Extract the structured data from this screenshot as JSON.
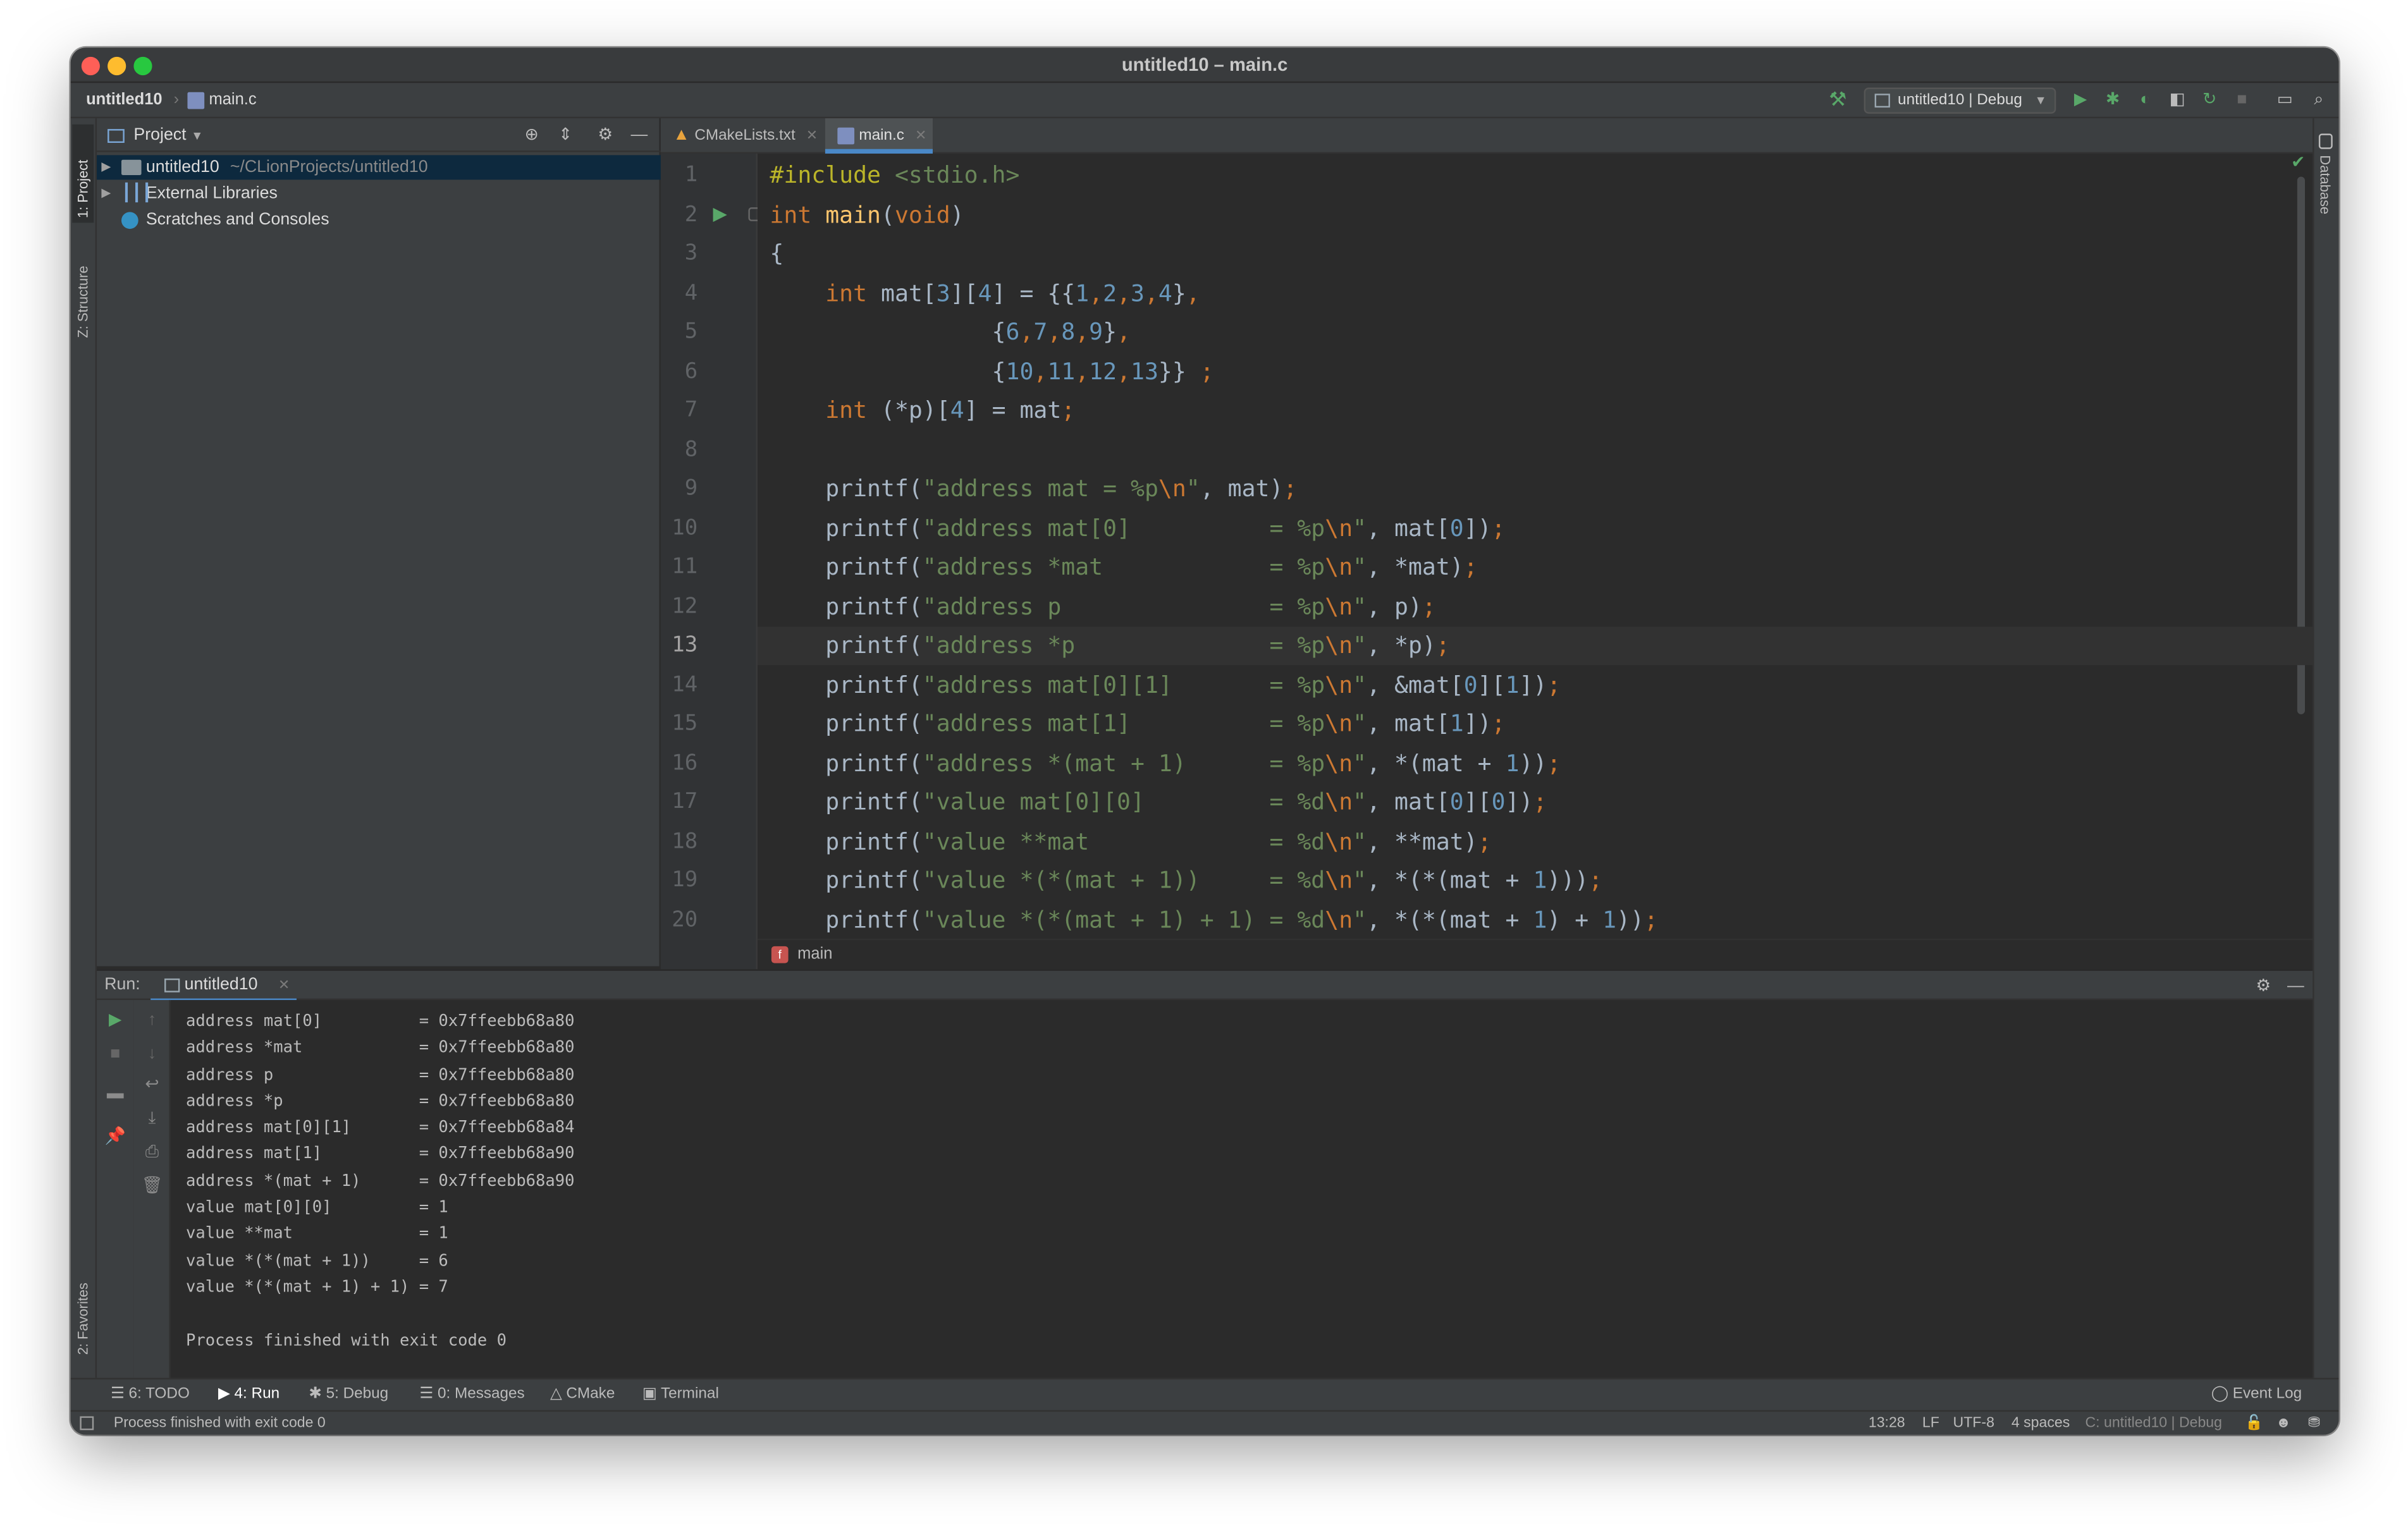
{
  "window": {
    "title": "untitled10 – main.c"
  },
  "nav": {
    "project": "untitled10",
    "file": "main.c",
    "run_config": "untitled10 | Debug"
  },
  "left_stripe": {
    "project": "1: Project",
    "structure": "Z: Structure",
    "favorites": "2: Favorites"
  },
  "right_stripe": {
    "database": "Database"
  },
  "project_panel": {
    "title": "Project",
    "tree": [
      {
        "label": "untitled10",
        "path": "~/CLionProjects/untitled10"
      },
      {
        "label": "External Libraries"
      },
      {
        "label": "Scratches and Consoles"
      }
    ]
  },
  "tabs": [
    {
      "label": "CMakeLists.txt"
    },
    {
      "label": "main.c"
    }
  ],
  "editor": {
    "current_line": 13,
    "breadcrumb": "main",
    "lines": [
      [
        {
          "t": "#include ",
          "c": "#bbb529"
        },
        {
          "t": "<stdio.h>",
          "c": "#6a8759"
        }
      ],
      [
        {
          "t": "int ",
          "c": "#cc7832"
        },
        {
          "t": "main",
          "c": "#ffc66d"
        },
        {
          "t": "(",
          "c": "#a9b7c6"
        },
        {
          "t": "void",
          "c": "#cc7832"
        },
        {
          "t": ")",
          "c": "#a9b7c6"
        }
      ],
      [
        {
          "t": "{",
          "c": "#a9b7c6"
        }
      ],
      [
        {
          "t": "    int ",
          "c": "#cc7832"
        },
        {
          "t": "mat[",
          "c": "#a9b7c6"
        },
        {
          "t": "3",
          "c": "#6897bb"
        },
        {
          "t": "][",
          "c": "#a9b7c6"
        },
        {
          "t": "4",
          "c": "#6897bb"
        },
        {
          "t": "] = {{",
          "c": "#a9b7c6"
        },
        {
          "t": "1",
          "c": "#6897bb"
        },
        {
          "t": ",",
          "c": "#cc7832"
        },
        {
          "t": "2",
          "c": "#6897bb"
        },
        {
          "t": ",",
          "c": "#cc7832"
        },
        {
          "t": "3",
          "c": "#6897bb"
        },
        {
          "t": ",",
          "c": "#cc7832"
        },
        {
          "t": "4",
          "c": "#6897bb"
        },
        {
          "t": "}",
          "c": "#a9b7c6"
        },
        {
          "t": ",",
          "c": "#cc7832"
        }
      ],
      [
        {
          "t": "                {",
          "c": "#a9b7c6"
        },
        {
          "t": "6",
          "c": "#6897bb"
        },
        {
          "t": ",",
          "c": "#cc7832"
        },
        {
          "t": "7",
          "c": "#6897bb"
        },
        {
          "t": ",",
          "c": "#cc7832"
        },
        {
          "t": "8",
          "c": "#6897bb"
        },
        {
          "t": ",",
          "c": "#cc7832"
        },
        {
          "t": "9",
          "c": "#6897bb"
        },
        {
          "t": "}",
          "c": "#a9b7c6"
        },
        {
          "t": ",",
          "c": "#cc7832"
        }
      ],
      [
        {
          "t": "                {",
          "c": "#a9b7c6"
        },
        {
          "t": "10",
          "c": "#6897bb"
        },
        {
          "t": ",",
          "c": "#cc7832"
        },
        {
          "t": "11",
          "c": "#6897bb"
        },
        {
          "t": ",",
          "c": "#cc7832"
        },
        {
          "t": "12",
          "c": "#6897bb"
        },
        {
          "t": ",",
          "c": "#cc7832"
        },
        {
          "t": "13",
          "c": "#6897bb"
        },
        {
          "t": "}} ",
          "c": "#a9b7c6"
        },
        {
          "t": ";",
          "c": "#cc7832"
        }
      ],
      [
        {
          "t": "    int ",
          "c": "#cc7832"
        },
        {
          "t": "(*p)[",
          "c": "#a9b7c6"
        },
        {
          "t": "4",
          "c": "#6897bb"
        },
        {
          "t": "] = mat",
          "c": "#a9b7c6"
        },
        {
          "t": ";",
          "c": "#cc7832"
        }
      ],
      [
        {
          "t": "",
          "c": "#a9b7c6"
        }
      ],
      [
        {
          "t": "    printf(",
          "c": "#a9b7c6"
        },
        {
          "t": "\"address mat = %p",
          "c": "#6a8759"
        },
        {
          "t": "\\n",
          "c": "#cc7832"
        },
        {
          "t": "\"",
          "c": "#6a8759"
        },
        {
          "t": ", mat)",
          "c": "#a9b7c6"
        },
        {
          "t": ";",
          "c": "#cc7832"
        }
      ],
      [
        {
          "t": "    printf(",
          "c": "#a9b7c6"
        },
        {
          "t": "\"address mat[0]          = %p",
          "c": "#6a8759"
        },
        {
          "t": "\\n",
          "c": "#cc7832"
        },
        {
          "t": "\"",
          "c": "#6a8759"
        },
        {
          "t": ", mat[",
          "c": "#a9b7c6"
        },
        {
          "t": "0",
          "c": "#6897bb"
        },
        {
          "t": "])",
          "c": "#a9b7c6"
        },
        {
          "t": ";",
          "c": "#cc7832"
        }
      ],
      [
        {
          "t": "    printf(",
          "c": "#a9b7c6"
        },
        {
          "t": "\"address *mat            = %p",
          "c": "#6a8759"
        },
        {
          "t": "\\n",
          "c": "#cc7832"
        },
        {
          "t": "\"",
          "c": "#6a8759"
        },
        {
          "t": ", *mat)",
          "c": "#a9b7c6"
        },
        {
          "t": ";",
          "c": "#cc7832"
        }
      ],
      [
        {
          "t": "    printf(",
          "c": "#a9b7c6"
        },
        {
          "t": "\"address p               = %p",
          "c": "#6a8759"
        },
        {
          "t": "\\n",
          "c": "#cc7832"
        },
        {
          "t": "\"",
          "c": "#6a8759"
        },
        {
          "t": ", p)",
          "c": "#a9b7c6"
        },
        {
          "t": ";",
          "c": "#cc7832"
        }
      ],
      [
        {
          "t": "    printf(",
          "c": "#a9b7c6"
        },
        {
          "t": "\"address *p              = %p",
          "c": "#6a8759"
        },
        {
          "t": "\\n",
          "c": "#cc7832"
        },
        {
          "t": "\"",
          "c": "#6a8759"
        },
        {
          "t": ", *p)",
          "c": "#a9b7c6"
        },
        {
          "t": ";",
          "c": "#cc7832"
        }
      ],
      [
        {
          "t": "    printf(",
          "c": "#a9b7c6"
        },
        {
          "t": "\"address mat[0][1]       = %p",
          "c": "#6a8759"
        },
        {
          "t": "\\n",
          "c": "#cc7832"
        },
        {
          "t": "\"",
          "c": "#6a8759"
        },
        {
          "t": ", &mat[",
          "c": "#a9b7c6"
        },
        {
          "t": "0",
          "c": "#6897bb"
        },
        {
          "t": "][",
          "c": "#a9b7c6"
        },
        {
          "t": "1",
          "c": "#6897bb"
        },
        {
          "t": "])",
          "c": "#a9b7c6"
        },
        {
          "t": ";",
          "c": "#cc7832"
        }
      ],
      [
        {
          "t": "    printf(",
          "c": "#a9b7c6"
        },
        {
          "t": "\"address mat[1]          = %p",
          "c": "#6a8759"
        },
        {
          "t": "\\n",
          "c": "#cc7832"
        },
        {
          "t": "\"",
          "c": "#6a8759"
        },
        {
          "t": ", mat[",
          "c": "#a9b7c6"
        },
        {
          "t": "1",
          "c": "#6897bb"
        },
        {
          "t": "])",
          "c": "#a9b7c6"
        },
        {
          "t": ";",
          "c": "#cc7832"
        }
      ],
      [
        {
          "t": "    printf(",
          "c": "#a9b7c6"
        },
        {
          "t": "\"address *(mat + 1)      = %p",
          "c": "#6a8759"
        },
        {
          "t": "\\n",
          "c": "#cc7832"
        },
        {
          "t": "\"",
          "c": "#6a8759"
        },
        {
          "t": ", *(mat + ",
          "c": "#a9b7c6"
        },
        {
          "t": "1",
          "c": "#6897bb"
        },
        {
          "t": "))",
          "c": "#a9b7c6"
        },
        {
          "t": ";",
          "c": "#cc7832"
        }
      ],
      [
        {
          "t": "    printf(",
          "c": "#a9b7c6"
        },
        {
          "t": "\"value mat[0][0]         = %d",
          "c": "#6a8759"
        },
        {
          "t": "\\n",
          "c": "#cc7832"
        },
        {
          "t": "\"",
          "c": "#6a8759"
        },
        {
          "t": ", mat[",
          "c": "#a9b7c6"
        },
        {
          "t": "0",
          "c": "#6897bb"
        },
        {
          "t": "][",
          "c": "#a9b7c6"
        },
        {
          "t": "0",
          "c": "#6897bb"
        },
        {
          "t": "])",
          "c": "#a9b7c6"
        },
        {
          "t": ";",
          "c": "#cc7832"
        }
      ],
      [
        {
          "t": "    printf(",
          "c": "#a9b7c6"
        },
        {
          "t": "\"value **mat             = %d",
          "c": "#6a8759"
        },
        {
          "t": "\\n",
          "c": "#cc7832"
        },
        {
          "t": "\"",
          "c": "#6a8759"
        },
        {
          "t": ", **mat)",
          "c": "#a9b7c6"
        },
        {
          "t": ";",
          "c": "#cc7832"
        }
      ],
      [
        {
          "t": "    printf(",
          "c": "#a9b7c6"
        },
        {
          "t": "\"value *(*(mat + 1))     = %d",
          "c": "#6a8759"
        },
        {
          "t": "\\n",
          "c": "#cc7832"
        },
        {
          "t": "\"",
          "c": "#6a8759"
        },
        {
          "t": ", *(*(mat + ",
          "c": "#a9b7c6"
        },
        {
          "t": "1",
          "c": "#6897bb"
        },
        {
          "t": ")))",
          "c": "#a9b7c6"
        },
        {
          "t": ";",
          "c": "#cc7832"
        }
      ],
      [
        {
          "t": "    printf(",
          "c": "#a9b7c6"
        },
        {
          "t": "\"value *(*(mat + 1) + 1) = %d",
          "c": "#6a8759"
        },
        {
          "t": "\\n",
          "c": "#cc7832"
        },
        {
          "t": "\"",
          "c": "#6a8759"
        },
        {
          "t": ", *(*(mat + ",
          "c": "#a9b7c6"
        },
        {
          "t": "1",
          "c": "#6897bb"
        },
        {
          "t": ") + ",
          "c": "#a9b7c6"
        },
        {
          "t": "1",
          "c": "#6897bb"
        },
        {
          "t": "))",
          "c": "#a9b7c6"
        },
        {
          "t": ";",
          "c": "#cc7832"
        }
      ]
    ]
  },
  "run": {
    "label": "Run:",
    "tab": "untitled10",
    "output": [
      "address mat[0]          = 0x7ffeebb68a80",
      "address *mat            = 0x7ffeebb68a80",
      "address p               = 0x7ffeebb68a80",
      "address *p              = 0x7ffeebb68a80",
      "address mat[0][1]       = 0x7ffeebb68a84",
      "address mat[1]          = 0x7ffeebb68a90",
      "address *(mat + 1)      = 0x7ffeebb68a90",
      "value mat[0][0]         = 1",
      "value **mat             = 1",
      "value *(*(mat + 1))     = 6",
      "value *(*(mat + 1) + 1) = 7",
      "",
      "Process finished with exit code 0"
    ]
  },
  "tool_tabs": {
    "todo": "6: TODO",
    "run": "4: Run",
    "debug": "5: Debug",
    "messages": "0: Messages",
    "cmake": "CMake",
    "terminal": "Terminal",
    "event_log": "Event Log"
  },
  "status": {
    "message": "Process finished with exit code 0",
    "position": "13:28",
    "line_sep": "LF",
    "encoding": "UTF-8",
    "indent": "4 spaces",
    "context": "C: untitled10 | Debug"
  },
  "colors": {
    "accent": "#4a88c7",
    "keyword": "#cc7832",
    "string": "#6a8759",
    "number": "#6897bb",
    "function": "#ffc66d",
    "preprocessor": "#bbb529",
    "run_green": "#59a869"
  }
}
